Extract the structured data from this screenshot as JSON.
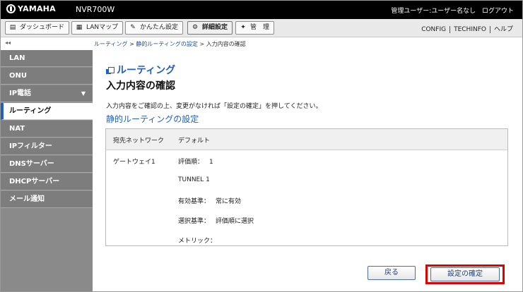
{
  "header": {
    "brand": "YAMAHA",
    "model": "NVR700W",
    "user_label": "管理ユーザー:ユーザー名なし",
    "logout": "ログアウト"
  },
  "menu": {
    "tabs": [
      {
        "label": "ダッシュボード",
        "icon": "dashboard-icon"
      },
      {
        "label": "LANマップ",
        "icon": "lan-map-icon"
      },
      {
        "label": "かんたん設定",
        "icon": "wizard-icon"
      },
      {
        "label": "詳細設定",
        "icon": "gear-icon"
      },
      {
        "label": "管　理",
        "icon": "wrench-icon"
      }
    ],
    "links": [
      "CONFIG",
      "TECHINFO",
      "ヘルプ"
    ]
  },
  "breadcrumb": {
    "item1": "ルーティング",
    "sep": " > ",
    "item2": "静的ルーティングの設定",
    "item3": "入力内容の確認"
  },
  "sidebar": {
    "items": [
      {
        "label": "LAN"
      },
      {
        "label": "ONU"
      },
      {
        "label": "IP電話"
      },
      {
        "label": "ルーティング"
      },
      {
        "label": "NAT"
      },
      {
        "label": "IPフィルター"
      },
      {
        "label": "DNSサーバー"
      },
      {
        "label": "DHCPサーバー"
      },
      {
        "label": "メール通知"
      }
    ],
    "active_index": 3
  },
  "main": {
    "section_title": "ルーティング",
    "page_heading": "入力内容の確認",
    "instruction": "入力内容をご確認の上、変更がなければ「設定の確定」を押してください。",
    "subheading": "静的ルーティングの設定",
    "detail": {
      "dest_label": "宛先ネットワーク",
      "dest_value": "デフォルト",
      "gateway_label": "ゲートウェイ1",
      "rows": [
        {
          "label": "評価順：",
          "value": "1"
        },
        {
          "label": "TUNNEL 1",
          "value": ""
        },
        {
          "label": "有効基準：",
          "value": "常に有効"
        },
        {
          "label": "選択基準：",
          "value": "評価順に選択"
        },
        {
          "label": "メトリック：",
          "value": ""
        }
      ]
    },
    "back_button": "戻る",
    "confirm_button": "設定の確定"
  },
  "colors": {
    "accent": "#1e5fbf",
    "sidebar_bg": "#7d7d7d",
    "highlight": "#e00000"
  }
}
